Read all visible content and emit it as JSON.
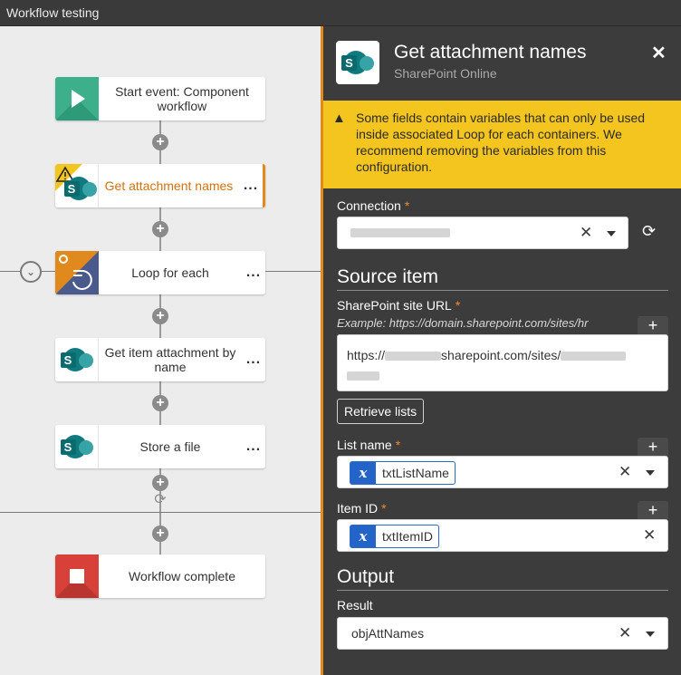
{
  "window": {
    "title": "Workflow testing"
  },
  "canvas": {
    "nodes": [
      {
        "label": "Start event: Component workflow",
        "icon": "play-icon"
      },
      {
        "label": "Get attachment names",
        "icon": "sharepoint-icon",
        "warning": true,
        "selected": true
      },
      {
        "label": "Loop for each",
        "icon": "loop-icon"
      },
      {
        "label": "Get item attachment by name",
        "icon": "sharepoint-icon"
      },
      {
        "label": "Store a file",
        "icon": "sharepoint-icon"
      },
      {
        "label": "Workflow complete",
        "icon": "stop-icon"
      }
    ],
    "more_glyph": "...",
    "add_glyph": "+"
  },
  "panel": {
    "title": "Get attachment names",
    "subtitle": "SharePoint Online",
    "close_glyph": "✕",
    "warning": "Some fields contain variables that can only be used inside associated Loop for each containers. We recommend removing the variables from this configuration.",
    "connection": {
      "label": "Connection",
      "required": "*"
    },
    "source_item": {
      "heading": "Source item",
      "site_url_label": "SharePoint site URL",
      "site_url_hint": "Example: https://domain.sharepoint.com/sites/hr",
      "site_url_prefix": "https://",
      "site_url_mid": "sharepoint.com/sites/",
      "retrieve_button": "Retrieve lists",
      "list_name_label": "List name",
      "list_name_value": "txtListName",
      "item_id_label": "Item ID",
      "item_id_value": "txtItemID"
    },
    "output": {
      "heading": "Output",
      "result_label": "Result",
      "result_value": "objAttNames"
    },
    "variable_glyph": "x",
    "clear_glyph": "✕",
    "add_glyph": "+"
  },
  "colors": {
    "accent_orange": "#e08a1e",
    "warning_yellow": "#f4c41f",
    "variable_blue": "#2463c8",
    "sharepoint_teal": "#0f7b7f",
    "start_green": "#3daf8a",
    "stop_red": "#d8413a"
  }
}
